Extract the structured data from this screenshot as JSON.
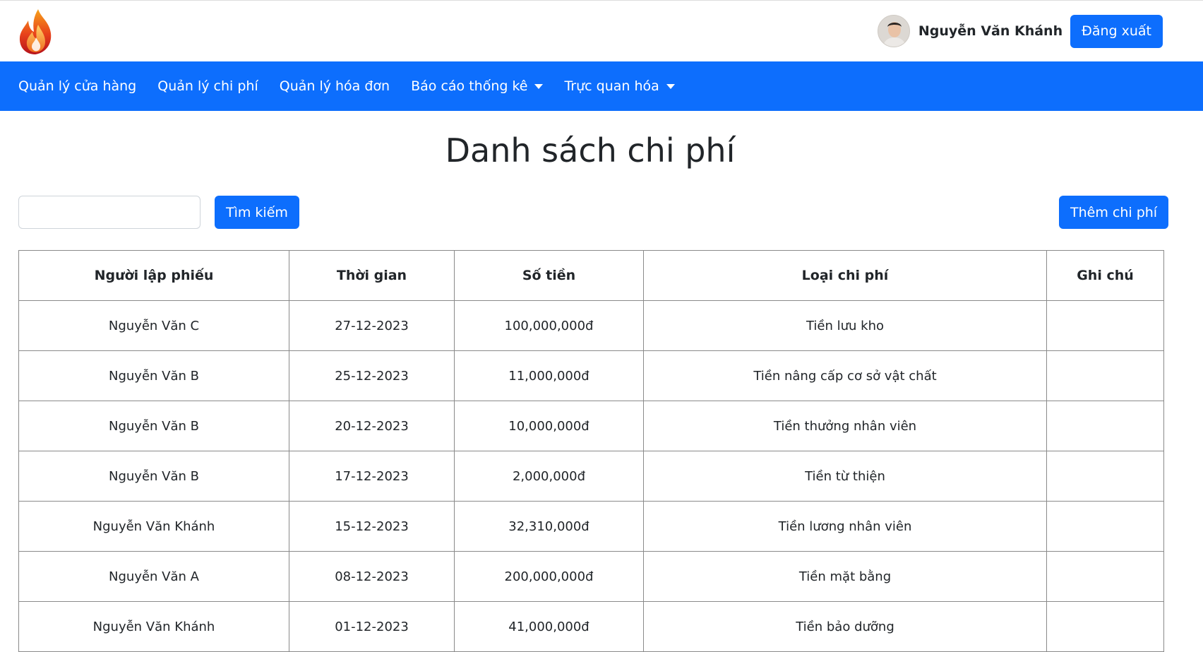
{
  "header": {
    "user_name": "Nguyễn Văn Khánh",
    "logout_label": "Đăng xuất"
  },
  "nav": {
    "items": [
      {
        "label": "Quản lý cửa hàng",
        "dropdown": false
      },
      {
        "label": "Quản lý chi phí",
        "dropdown": false
      },
      {
        "label": "Quản lý hóa đơn",
        "dropdown": false
      },
      {
        "label": "Báo cáo thống kê",
        "dropdown": true
      },
      {
        "label": "Trực quan hóa",
        "dropdown": true
      }
    ]
  },
  "main": {
    "title": "Danh sách chi phí",
    "search": {
      "value": "",
      "placeholder": "",
      "button_label": "Tìm kiếm"
    },
    "add_label": "Thêm chi phí",
    "table": {
      "headers": [
        "Người lập phiếu",
        "Thời gian",
        "Số tiền",
        "Loại chi phí",
        "Ghi chú"
      ],
      "rows": [
        [
          "Nguyễn Văn C",
          "27-12-2023",
          "100,000,000đ",
          "Tiền lưu kho",
          ""
        ],
        [
          "Nguyễn Văn B",
          "25-12-2023",
          "11,000,000đ",
          "Tiền nâng cấp cơ sở vật chất",
          ""
        ],
        [
          "Nguyễn Văn B",
          "20-12-2023",
          "10,000,000đ",
          "Tiền thưởng nhân viên",
          ""
        ],
        [
          "Nguyễn Văn B",
          "17-12-2023",
          "2,000,000đ",
          "Tiền từ thiện",
          ""
        ],
        [
          "Nguyễn Văn Khánh",
          "15-12-2023",
          "32,310,000đ",
          "Tiền lương nhân viên",
          ""
        ],
        [
          "Nguyễn Văn A",
          "08-12-2023",
          "200,000,000đ",
          "Tiền mặt bằng",
          ""
        ],
        [
          "Nguyễn Văn Khánh",
          "01-12-2023",
          "41,000,000đ",
          "Tiền bảo dưỡng",
          ""
        ]
      ]
    }
  },
  "colors": {
    "primary": "#0d6efd",
    "text": "#212529",
    "border": "#8a8a8a"
  },
  "icons": {
    "logo": "flame-logo-icon",
    "caret": "caret-down-icon"
  }
}
